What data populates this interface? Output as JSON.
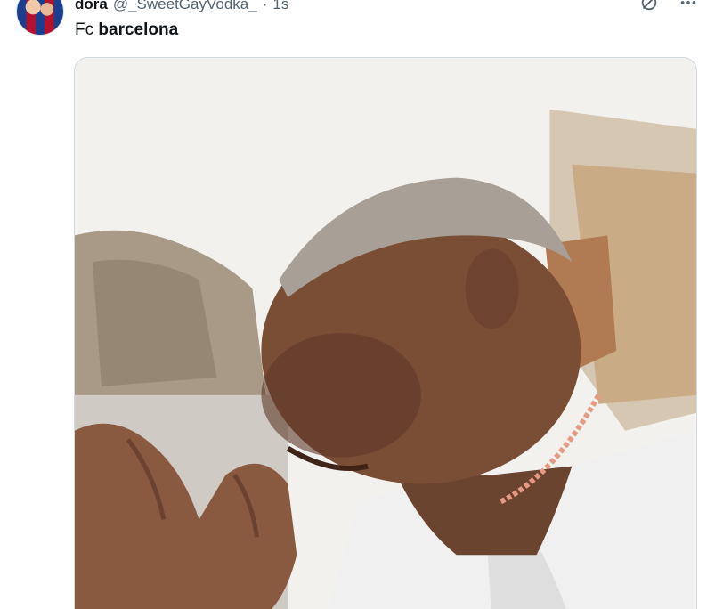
{
  "tweet": {
    "author_name": "dora",
    "author_handle": "@_SweetGayVodka_",
    "separator": "·",
    "timestamp": "1s",
    "text_prefix": "Fc",
    "text_bold": "barcelona",
    "avatar_icon": "avatar-fcb-photo",
    "media_icon": "video-frame"
  },
  "actions": {
    "grok_icon": "grok-icon",
    "more_icon": "more-icon"
  },
  "colors": {
    "text_primary": "#0f1419",
    "text_secondary": "#536471",
    "media_border": "#cfd9de"
  }
}
